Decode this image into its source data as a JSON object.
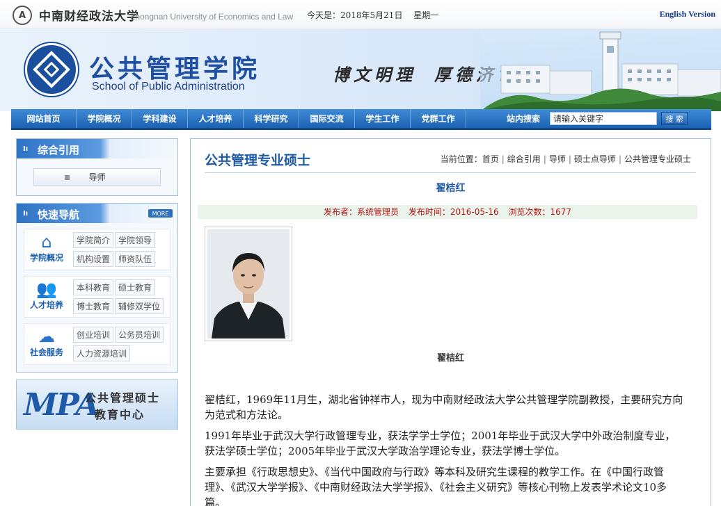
{
  "topbar": {
    "logo_char": "A",
    "university_cn": "中南财经政法大学",
    "university_en": "Zhongnan University of Economics and Law",
    "today_label": "今天是：2018年5月21日",
    "weekday": "星期一",
    "english_link": "English Version"
  },
  "banner": {
    "school_cn": "公共管理学院",
    "school_en": "School of Public Administration",
    "motto_1": "博文明理",
    "motto_2": "厚德济世"
  },
  "nav": {
    "items": [
      {
        "label": "网站首页"
      },
      {
        "label": "学院概况"
      },
      {
        "label": "学科建设"
      },
      {
        "label": "人才培养"
      },
      {
        "label": "科学研究"
      },
      {
        "label": "国际交流"
      },
      {
        "label": "学生工作"
      },
      {
        "label": "党群工作"
      }
    ],
    "search_label": "站内搜索",
    "search_value": "请输入关键字",
    "search_button": "搜 索"
  },
  "sidebar": {
    "panel1_title": "综合引用",
    "mentor_button": "导师",
    "panel2_title": "快速导航",
    "more_label": "MORE",
    "groups": [
      {
        "label": "学院概况",
        "icon": "home-icon",
        "links": [
          "学院简介",
          "学院领导",
          "机构设置",
          "师资队伍"
        ]
      },
      {
        "label": "人才培养",
        "icon": "people-icon",
        "links": [
          "本科教育",
          "硕士教育",
          "博士教育",
          "辅修双学位"
        ]
      },
      {
        "label": "社会服务",
        "icon": "service-icon",
        "links": [
          "创业培训",
          "公务员培训",
          "人力资源培训"
        ]
      }
    ],
    "mpa_big": "MPA",
    "mpa_line1": "公共管理硕士",
    "mpa_line2": "教育中心"
  },
  "main": {
    "section_title": "公共管理专业硕士",
    "crumb_prefix": "当前位置：",
    "crumbs": [
      "首页",
      "综合引用",
      "导师",
      "硕士点导师",
      "公共管理专业硕士"
    ],
    "article_title": "翟桔红",
    "meta_publisher": "发布者：系统管理员",
    "meta_time": "发布时间：2016-05-16",
    "meta_views": "浏览次数：1677",
    "photo_caption": "翟桔红",
    "paragraphs": [
      "翟桔红，1969年11月生，湖北省钟祥市人，现为中南财经政法大学公共管理学院副教授，主要研究方向为范式和方法论。",
      "1991年毕业于武汉大学行政管理专业，获法学学士学位；2001年毕业于武汉大学中外政治制度专业，获法学硕士学位；2005年毕业于武汉大学政治学理论专业，获法学博士学位。",
      "主要承担《行政思想史》、《当代中国政府与行政》等本科及研究生课程的教学工作。在《中国行政管理》、《武汉大学学报》、《中南财经政法大学学报》、《社会主义研究》等核心刊物上发表学术论文10多篇。"
    ]
  },
  "colors": {
    "brand_blue": "#1e4fa3",
    "nav_blue": "#1b62b3",
    "meta_red": "#b31212"
  }
}
